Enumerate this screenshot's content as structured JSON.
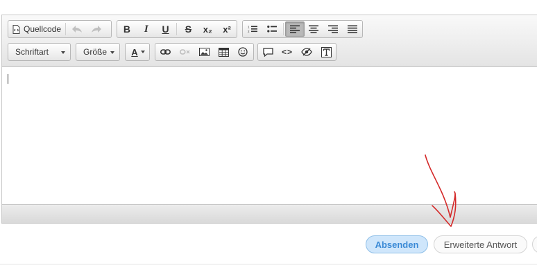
{
  "toolbar": {
    "source_label": "Quellcode",
    "font_label": "Schriftart",
    "size_label": "Größe",
    "color_glyph": "A"
  },
  "buttons": {
    "bold": "B",
    "italic": "I",
    "underline": "U",
    "strike": "S",
    "subscript": "x₂",
    "superscript": "x²",
    "code": "<>"
  },
  "active_alignment": "left",
  "actions": {
    "submit_label": "Absenden",
    "advanced_label": "Erweiterte Antwort"
  },
  "colors": {
    "primary_button_bg": "#cfe6fb",
    "primary_button_text": "#3b8ad6",
    "annotation": "#d42a2a"
  }
}
